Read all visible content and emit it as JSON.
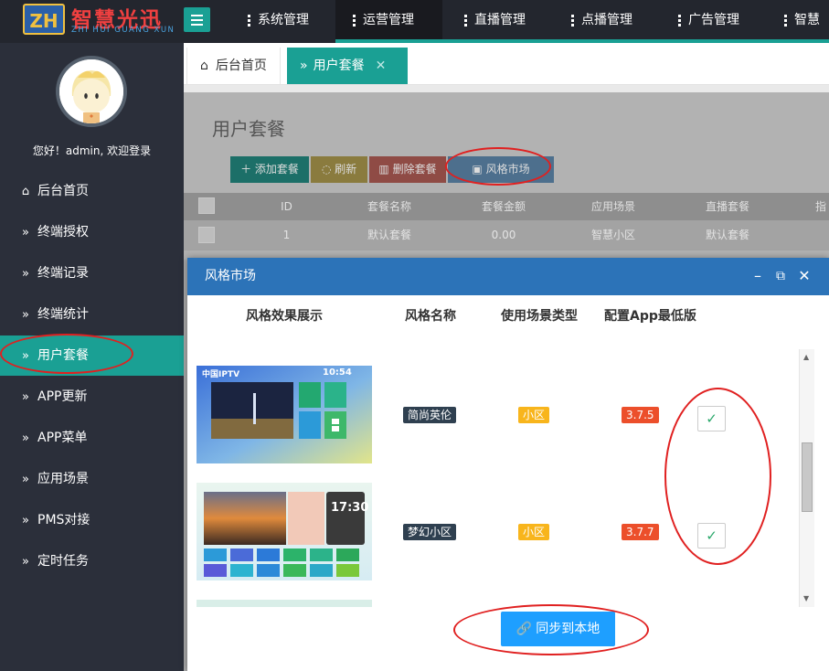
{
  "brand": {
    "logo_mark": "ZH",
    "name_cn": "智慧光迅",
    "name_en": "ZHI HUI GUANG XUN"
  },
  "nav": [
    {
      "label": "系统管理"
    },
    {
      "label": "运营管理"
    },
    {
      "label": "直播管理"
    },
    {
      "label": "点播管理"
    },
    {
      "label": "广告管理"
    },
    {
      "label": "智慧"
    }
  ],
  "sidebar": {
    "welcome": "您好！admin, 欢迎登录",
    "items": [
      {
        "label": "后台首页",
        "icon": "home-icon"
      },
      {
        "label": "终端授权",
        "icon": "double-chevron-icon"
      },
      {
        "label": "终端记录",
        "icon": "double-chevron-icon"
      },
      {
        "label": "终端统计",
        "icon": "double-chevron-icon"
      },
      {
        "label": "用户套餐",
        "icon": "double-chevron-icon"
      },
      {
        "label": "APP更新",
        "icon": "double-chevron-icon"
      },
      {
        "label": "APP菜单",
        "icon": "double-chevron-icon"
      },
      {
        "label": "应用场景",
        "icon": "double-chevron-icon"
      },
      {
        "label": "PMS对接",
        "icon": "double-chevron-icon"
      },
      {
        "label": "定时任务",
        "icon": "double-chevron-icon"
      }
    ]
  },
  "tabs": [
    {
      "label": "后台首页"
    },
    {
      "label": "用户套餐"
    }
  ],
  "page": {
    "title": "用户套餐",
    "toolbar": {
      "add": "添加套餐",
      "refresh": "刷新",
      "delete": "删除套餐",
      "style_market": "风格市场"
    },
    "table": {
      "headers": [
        "ID",
        "套餐名称",
        "套餐金额",
        "应用场景",
        "直播套餐",
        "指"
      ],
      "rows": [
        [
          "1",
          "默认套餐",
          "0.00",
          "智慧小区",
          "默认套餐"
        ]
      ]
    }
  },
  "modal": {
    "title": "风格市场",
    "columns": [
      "风格效果展示",
      "风格名称",
      "使用场景类型",
      "配置App最低版"
    ],
    "rows": [
      {
        "name": "简尚英伦",
        "scene": "小区",
        "version": "3.7.5",
        "checked": "✓",
        "thumb_text": "中国IPTV",
        "thumb_time": "10:54"
      },
      {
        "name": "梦幻小区",
        "scene": "小区",
        "version": "3.7.7",
        "checked": "✓",
        "thumb_text": "",
        "thumb_time": "17:30"
      }
    ],
    "sync_button": "同步到本地"
  },
  "colors": {
    "accent": "#1aa094",
    "topbar": "#23262e",
    "sidebar": "#2b2f3a",
    "modal_head": "#2c73b8",
    "sync": "#1e9fff",
    "annotation": "#e02020"
  }
}
